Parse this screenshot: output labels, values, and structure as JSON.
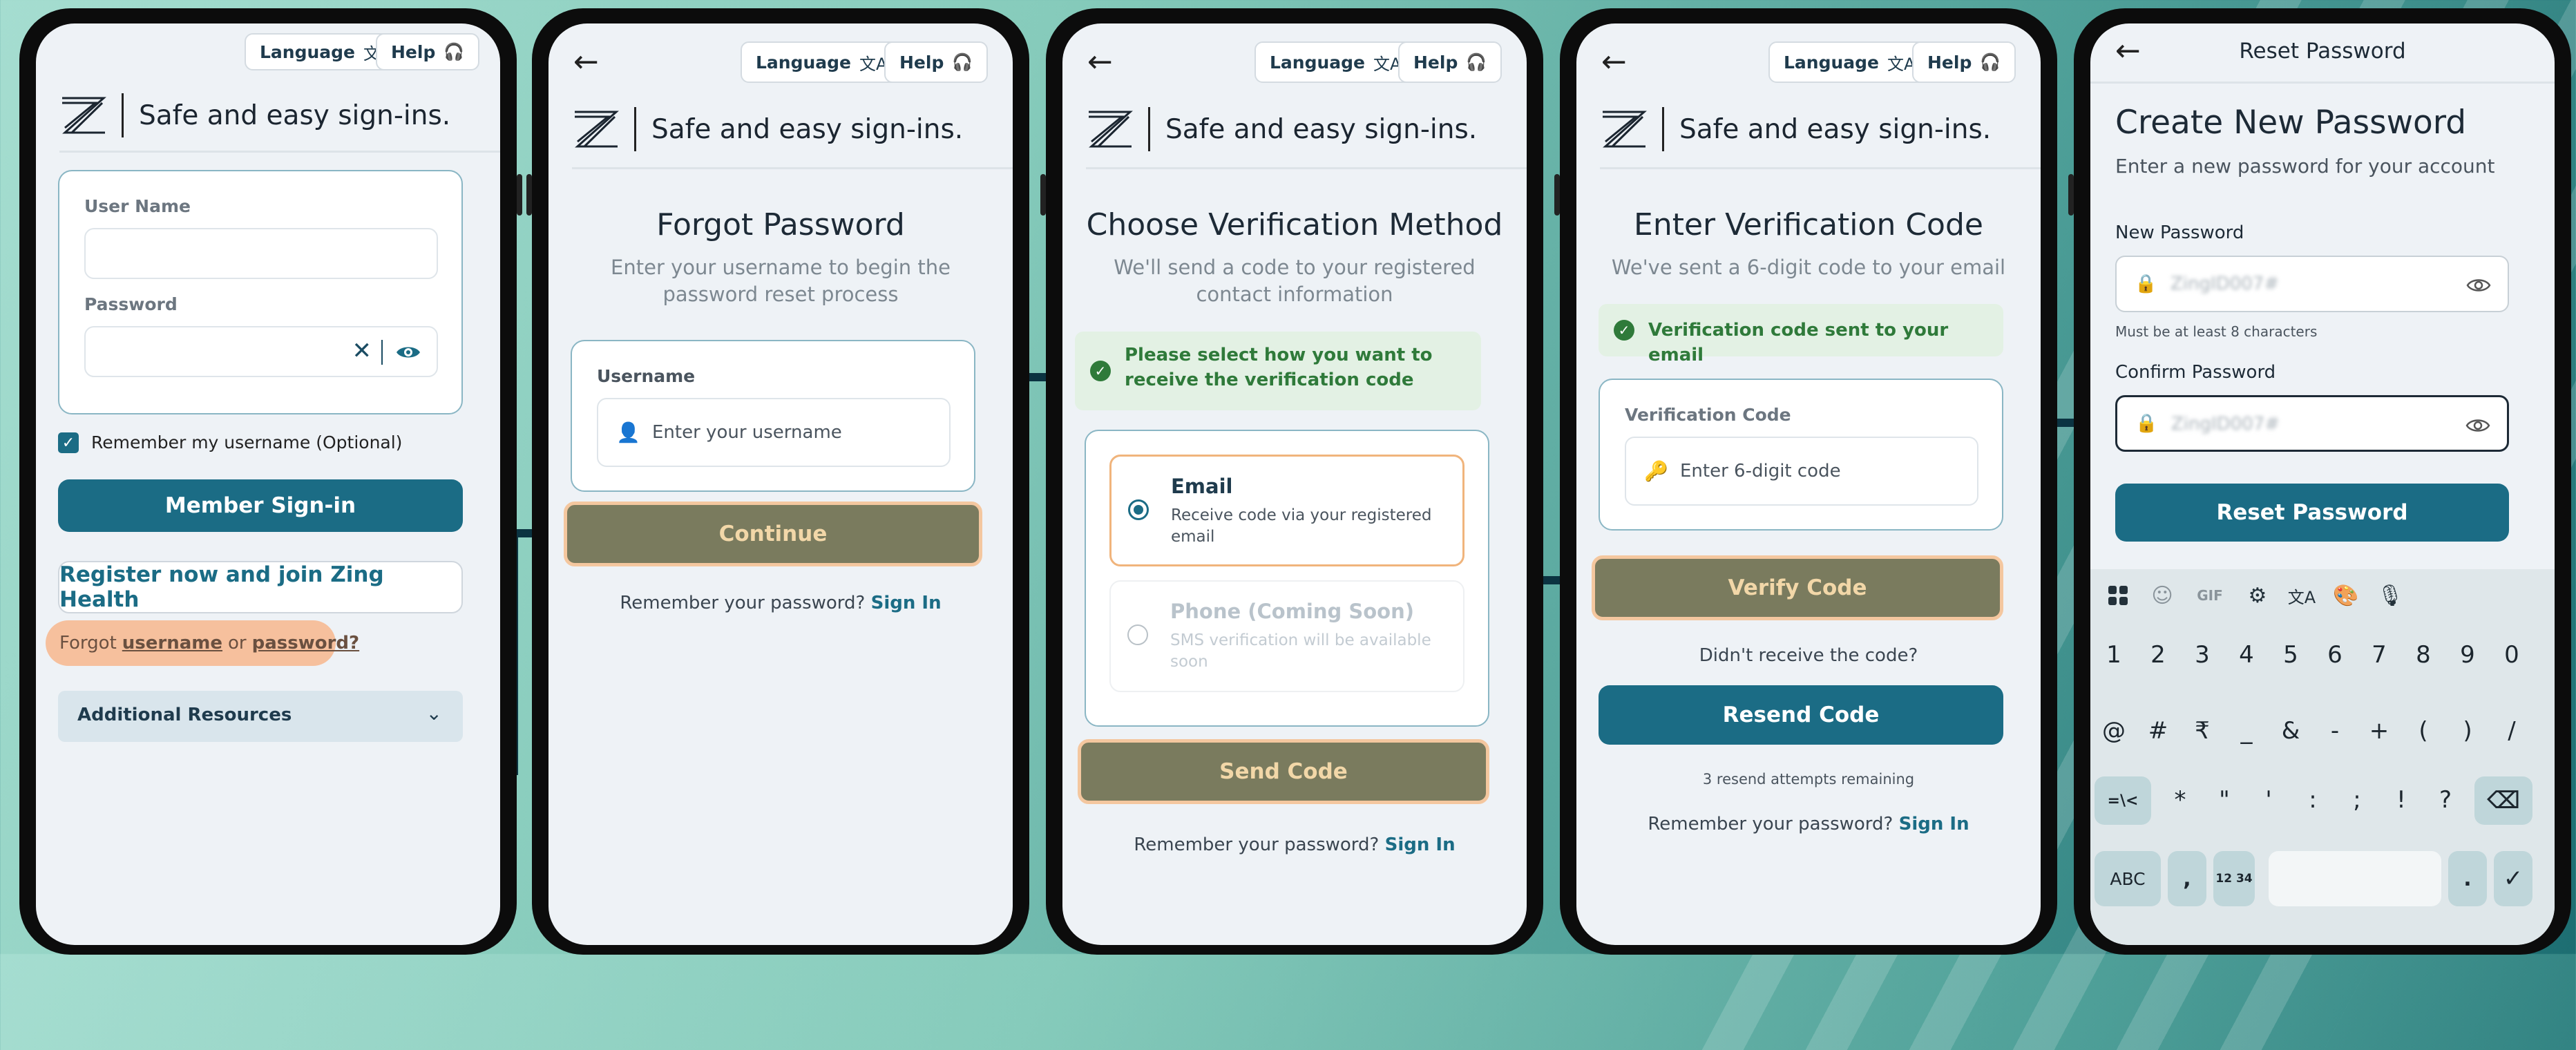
{
  "common": {
    "language": "Language",
    "help": "Help",
    "brand_tagline": "Safe and easy sign-ins.",
    "remember_prompt": "Remember your password?",
    "sign_in": "Sign In"
  },
  "login": {
    "user_name_label": "User Name",
    "password_label": "Password",
    "remember_me": "Remember my username (Optional)",
    "member_signin": "Member Sign-in",
    "register": "Register now and join Zing Health",
    "forgot_prefix": "Forgot",
    "forgot_username": "username",
    "forgot_or": "or",
    "forgot_password": "password?",
    "additional_resources": "Additional Resources"
  },
  "forgot": {
    "title": "Forgot Password",
    "subtitle": "Enter your username to begin the password reset process",
    "username_label": "Username",
    "username_placeholder": "Enter your username",
    "continue": "Continue"
  },
  "verify_method": {
    "title": "Choose Verification Method",
    "subtitle": "We'll send a code to your registered contact information",
    "alert": "Please select how you want to receive the verification code",
    "email_title": "Email",
    "email_desc": "Receive code via your registered email",
    "phone_title": "Phone (Coming Soon)",
    "phone_desc": "SMS verification will be available soon",
    "send_code": "Send Code"
  },
  "verify_code": {
    "title": "Enter Verification Code",
    "subtitle": "We've sent a 6-digit code to your email",
    "alert": "Verification code sent to your email",
    "code_label": "Verification Code",
    "code_placeholder": "Enter 6-digit code",
    "verify": "Verify Code",
    "didnt_receive": "Didn't receive the code?",
    "resend": "Resend Code",
    "attempts": "3 resend attempts remaining"
  },
  "reset": {
    "header": "Reset Password",
    "title": "Create New Password",
    "subtitle": "Enter a new password for your account",
    "new_label": "New Password",
    "new_value": "ZingID007#",
    "hint": "Must be at least 8 characters",
    "confirm_label": "Confirm Password",
    "confirm_value": "ZingID007#",
    "button": "Reset Password"
  },
  "keyboard": {
    "tools": [
      "apps-icon",
      "sticker-icon",
      "GIF",
      "settings-icon",
      "translate-icon",
      "palette-icon",
      "mic-icon"
    ],
    "row1": [
      "1",
      "2",
      "3",
      "4",
      "5",
      "6",
      "7",
      "8",
      "9",
      "0"
    ],
    "row2": [
      "@",
      "#",
      "₹",
      "_",
      "&",
      "-",
      "+",
      "(",
      ")",
      "/"
    ],
    "row3": [
      "*",
      "\"",
      "'",
      ":",
      ";",
      "!",
      "?"
    ],
    "sym_key": "=\\<",
    "abc": "ABC",
    "comma": ",",
    "num_key": "12 34",
    "period": "."
  },
  "colors": {
    "primary": "#1b6c85",
    "olive": "#7a7b5e",
    "highlight": "#f4c79f",
    "success": "#2f7a3a",
    "connector": "#0b3341"
  }
}
